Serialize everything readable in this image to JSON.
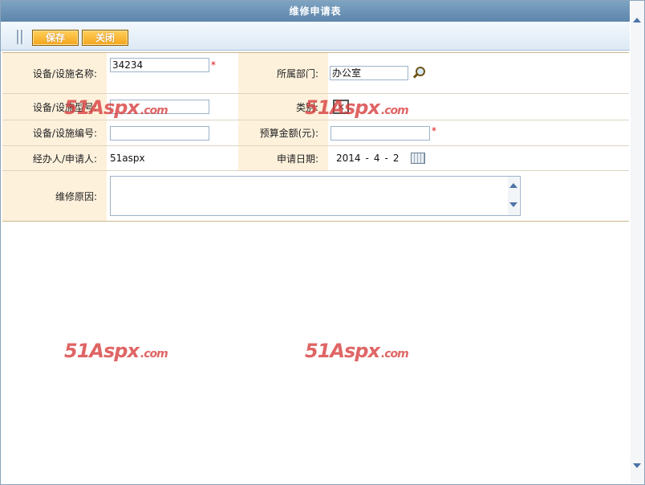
{
  "window": {
    "title": "维修申请表"
  },
  "toolbar": {
    "save_label": "保存",
    "close_label": "关闭"
  },
  "form": {
    "row1": {
      "label_a": "设备/设施名称:",
      "value_a": "34234",
      "label_b": "所属部门:",
      "value_b": "办公室"
    },
    "row2": {
      "label_a": "设备/设施型号:",
      "value_a": "",
      "label_b": "类别:",
      "value_b": "×"
    },
    "row3": {
      "label_a": "设备/设施编号:",
      "value_a": "",
      "label_b": "预算金额(元):",
      "value_b": ""
    },
    "row4": {
      "label_a": "经办人/申请人:",
      "value_a": "51aspx",
      "label_b": "申请日期:",
      "date_year": "2014",
      "date_month": "4",
      "date_day": "2",
      "date_sep": "-"
    },
    "row5": {
      "label": "维修原因:",
      "value": ""
    },
    "required_mark": "*"
  },
  "watermark": {
    "brand": "51Aspx",
    "domain": ".com"
  },
  "colors": {
    "accent": "#f5a51d",
    "title_bg": "#6a91b5",
    "label_bg": "#fdf1dc"
  }
}
